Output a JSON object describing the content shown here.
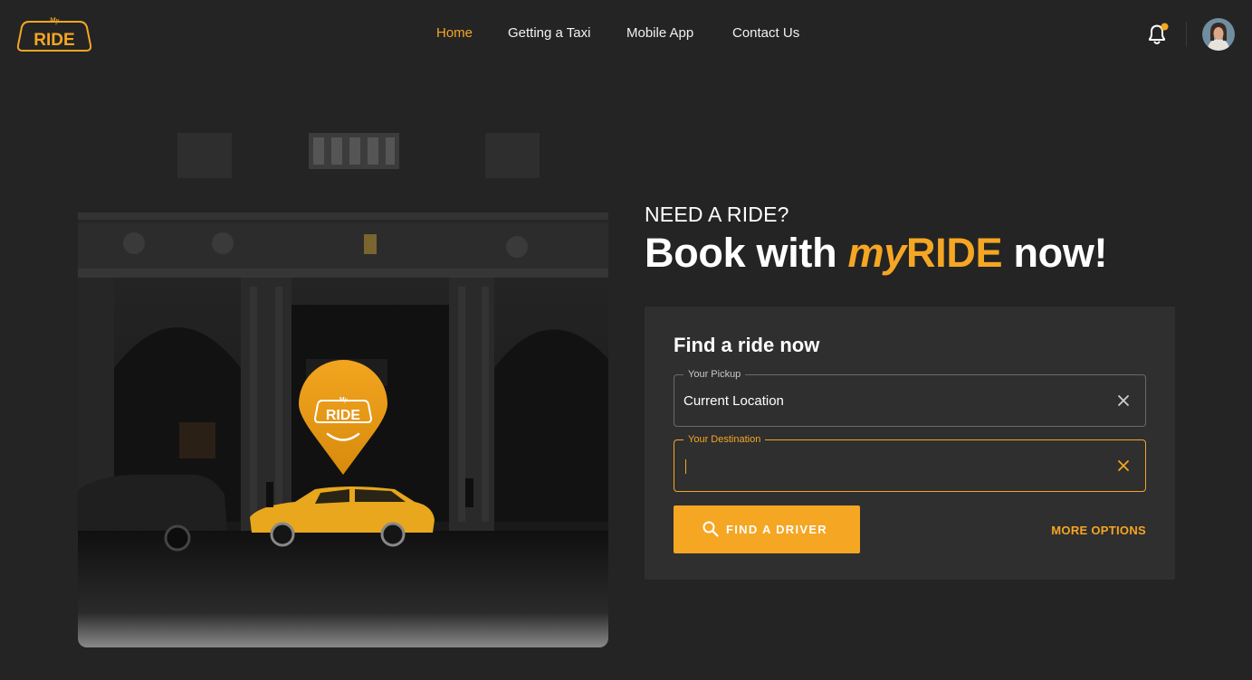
{
  "brand": {
    "logo_top": "My",
    "logo_main": "RIDE",
    "accent_color": "#f5a623",
    "background_color": "#242424"
  },
  "nav": {
    "items": [
      {
        "label": "Home",
        "active": true
      },
      {
        "label": "Getting a Taxi",
        "active": false
      },
      {
        "label": "Mobile App",
        "active": false
      },
      {
        "label": "Contact Us",
        "active": false
      }
    ],
    "icons": {
      "notifications": "bell-icon",
      "notification_badge": true,
      "profile": "avatar"
    }
  },
  "hero": {
    "image": "night-city-street-yellow-taxi",
    "pin_logo_top": "My",
    "pin_logo_main": "RIDE"
  },
  "intro": {
    "eyebrow": "NEED A RIDE?",
    "headline_prefix": "Book with ",
    "headline_brand_my": "my",
    "headline_brand_ride": "RIDE",
    "headline_suffix": " now!"
  },
  "finder": {
    "title": "Find a ride now",
    "pickup": {
      "label": "Your Pickup",
      "value": "Current Location",
      "clear_icon": "close-icon"
    },
    "destination": {
      "label": "Your Destination",
      "value": "",
      "focused": true,
      "clear_icon": "close-icon"
    },
    "find_button": {
      "label": "FIND A DRIVER",
      "icon": "search-icon"
    },
    "more_options": "MORE OPTIONS"
  }
}
